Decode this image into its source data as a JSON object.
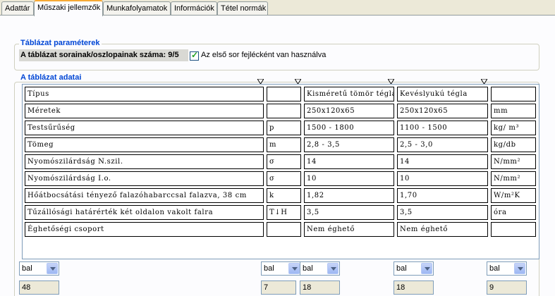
{
  "tabs": [
    "Adattár",
    "Műszaki jellemzők",
    "Munkafolyamatok",
    "Információk",
    "Tétel normák"
  ],
  "params": {
    "title": "Táblázat paraméterek",
    "rows_cols_label": "A táblázat sorainak/oszlopainak száma: 9/5",
    "header_checkbox_label": "Az első sor fejlécként van használva",
    "header_checked": true
  },
  "data_section": {
    "title": "A táblázat adatai",
    "rows": [
      [
        "Típus",
        "",
        "Kisméretű tömör tégla",
        "Kevéslyukú tégla",
        ""
      ],
      [
        "Méretek",
        "",
        "250x120x65",
        "250x120x65",
        "mm"
      ],
      [
        "Testsűrűség",
        "p",
        "1500 - 1800",
        "1100 - 1500",
        "kg/ m³"
      ],
      [
        "Tömeg",
        "m",
        "2,8 - 3,5",
        "2,5 - 3,0",
        "kg/db"
      ],
      [
        "Nyomószilárdság N.szil.",
        "σ",
        "14",
        "14",
        "N/mm²"
      ],
      [
        "Nyomószilárdság I.o.",
        "σ",
        "10",
        "10",
        "N/mm²"
      ],
      [
        "Hőátbocsátási tényező falazóhabarccsal falazva, 38 cm",
        "k",
        "1,82",
        "1,70",
        "W/m²K"
      ],
      [
        "Tűzállósági határérték két oldalon vakolt falra",
        "T↓H",
        "3,5",
        "3,5",
        "óra"
      ],
      [
        "Éghetőségi csoport",
        "",
        "Nem éghető",
        "Nem éghető",
        ""
      ]
    ],
    "alignments": [
      "bal",
      "bal",
      "bal",
      "bal",
      "bal"
    ],
    "widths": [
      "48",
      "7",
      "18",
      "18",
      "9"
    ]
  }
}
